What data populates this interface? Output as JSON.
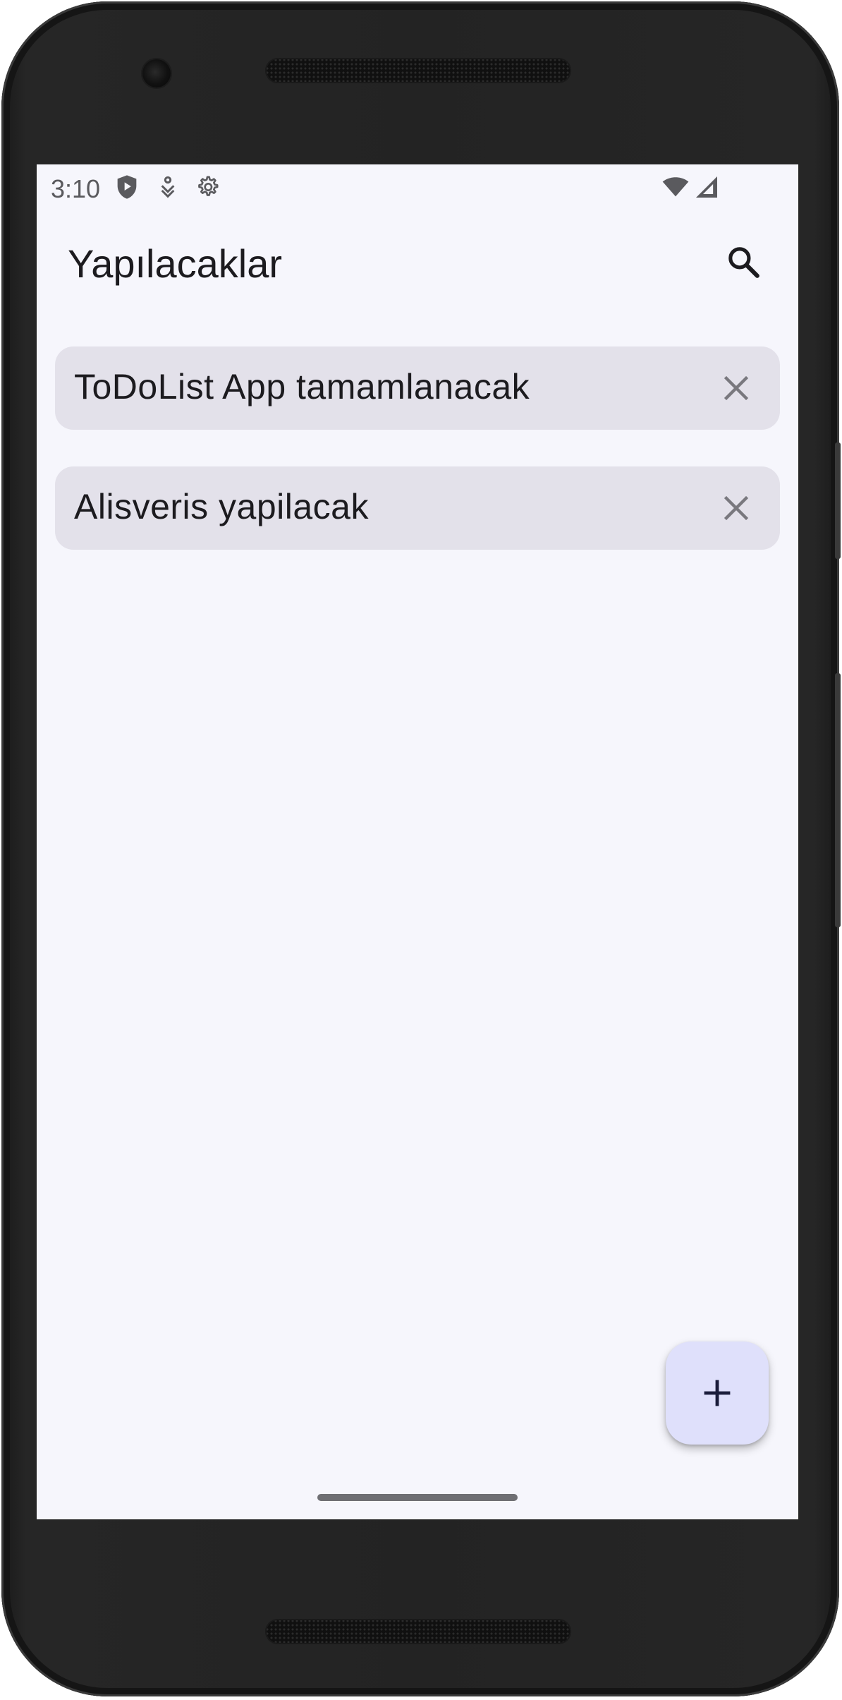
{
  "status_bar": {
    "time": "3:10",
    "icons": [
      "play-protect-icon",
      "download-icon",
      "settings-icon",
      "wifi-icon",
      "signal-icon"
    ]
  },
  "toolbar": {
    "title": "Yapılacaklar",
    "search_icon": "search-icon"
  },
  "todos": [
    {
      "text": "ToDoList App tamamlanacak",
      "delete_icon": "close-icon"
    },
    {
      "text": "Alisveris yapilacak",
      "delete_icon": "close-icon"
    }
  ],
  "fab": {
    "icon": "plus-icon"
  },
  "colors": {
    "background": "#f6f6fc",
    "card": "#e3e1ea",
    "fab": "#dfe0fb",
    "text": "#1c1b1f",
    "icon": "#79787e"
  }
}
